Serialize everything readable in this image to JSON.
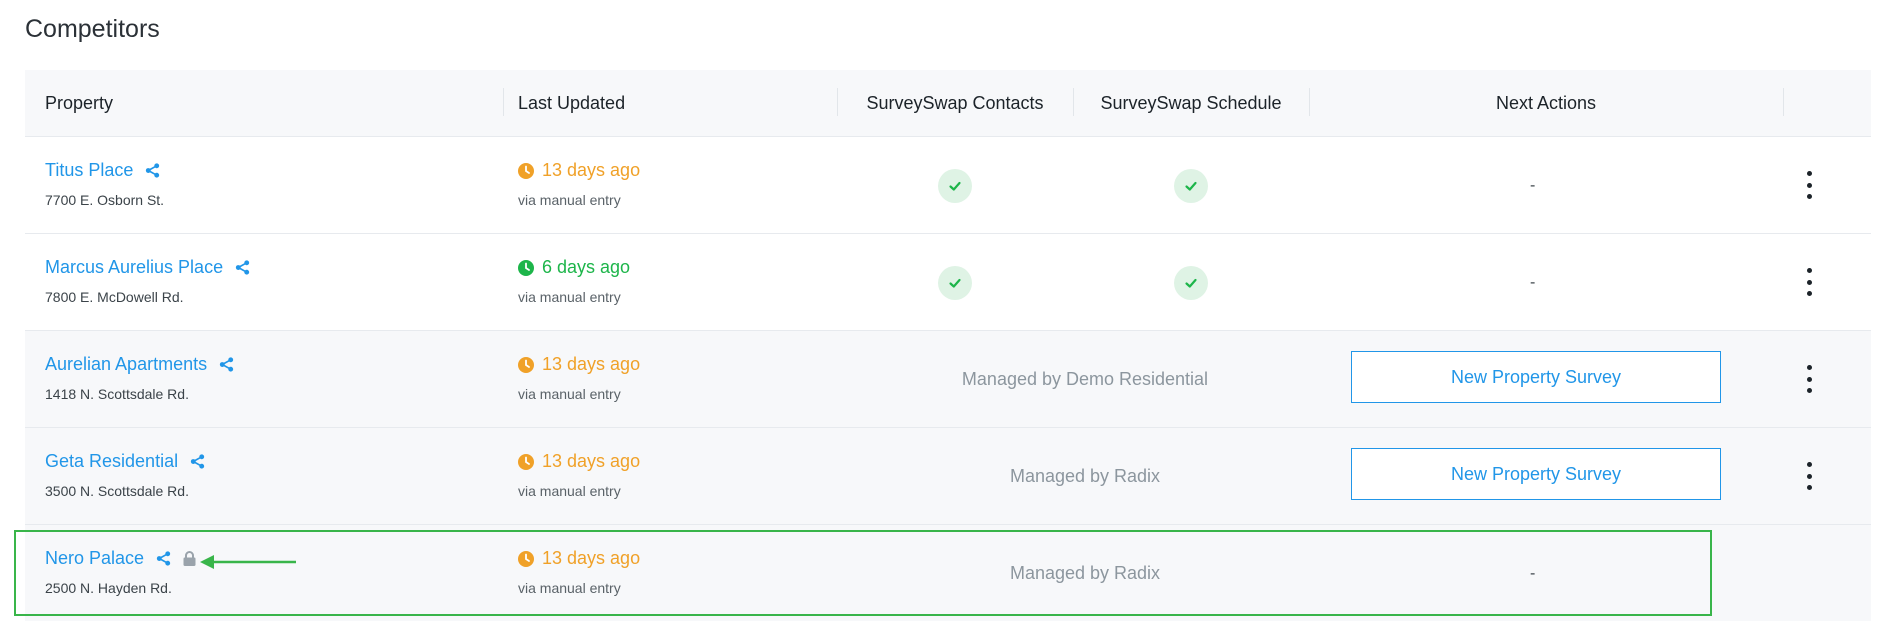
{
  "page": {
    "title": "Competitors"
  },
  "columns": {
    "property": "Property",
    "last_updated": "Last Updated",
    "contacts": "SurveySwap Contacts",
    "schedule": "SurveySwap Schedule",
    "next_actions": "Next Actions"
  },
  "rows": [
    {
      "name": "Titus Place",
      "address": "7700 E. Osborn St.",
      "updated": "13 days ago",
      "updated_color": "#f0a128",
      "source": "via manual entry",
      "contacts": true,
      "schedule": true,
      "next_action": "-"
    },
    {
      "name": "Marcus Aurelius Place",
      "address": "7800 E. McDowell Rd.",
      "updated": "6 days ago",
      "updated_color": "#1db54a",
      "source": "via manual entry",
      "contacts": true,
      "schedule": true,
      "next_action": "-"
    },
    {
      "name": "Aurelian Apartments",
      "address": "1418 N. Scottsdale Rd.",
      "updated": "13 days ago",
      "updated_color": "#f0a128",
      "source": "via manual entry",
      "managed_by": "Managed by Demo Residential",
      "next_action": "New Property Survey"
    },
    {
      "name": "Geta Residential",
      "address": "3500 N. Scottsdale Rd.",
      "updated": "13 days ago",
      "updated_color": "#f0a128",
      "source": "via manual entry",
      "managed_by": "Managed by Radix",
      "next_action": "New Property Survey"
    },
    {
      "name": "Nero Palace",
      "address": "2500 N. Hayden Rd.",
      "updated": "13 days ago",
      "updated_color": "#f0a128",
      "source": "via manual entry",
      "managed_by": "Managed by Radix",
      "next_action": "-",
      "locked": true
    }
  ],
  "icons": {
    "share": "share-icon",
    "clock": "clock-icon",
    "check": "check-icon",
    "lock": "lock-icon",
    "kebab": "kebab-menu-icon"
  },
  "colors": {
    "link": "#2196e8",
    "orange": "#f0a128",
    "green": "#1db54a",
    "highlight": "#39b54a"
  }
}
